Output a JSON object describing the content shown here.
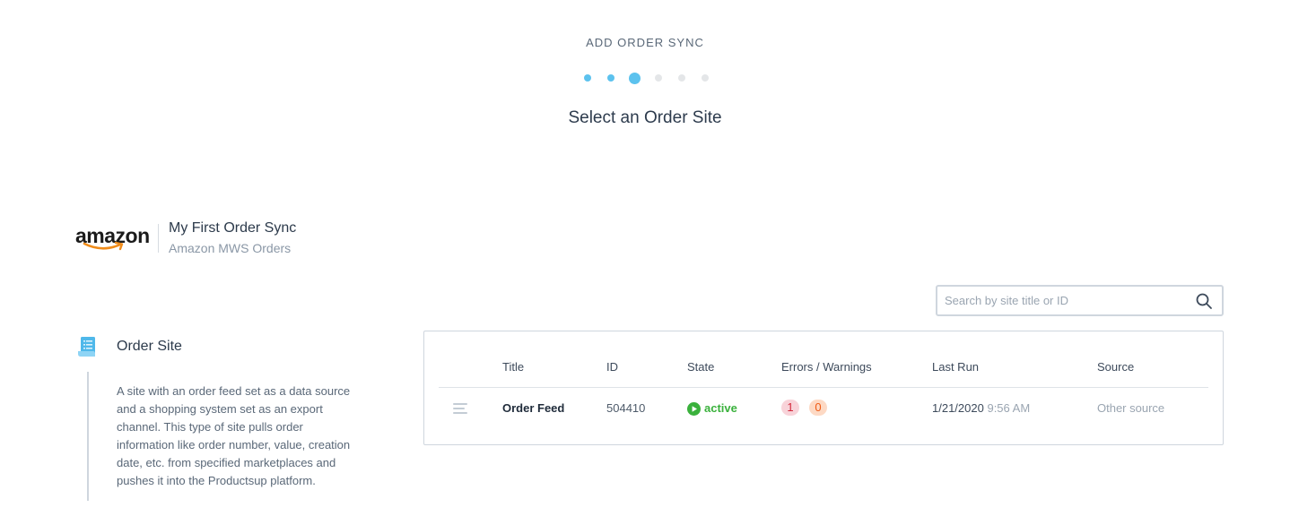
{
  "wizard": {
    "kicker": "ADD ORDER SYNC",
    "title": "Select an Order Site",
    "steps_total": 6,
    "current_step": 3,
    "accent_color": "#5cc2ee"
  },
  "sync": {
    "logo_text": "amazon",
    "logo_icon": "amazon-logo",
    "name": "My First Order Sync",
    "type": "Amazon MWS Orders"
  },
  "search": {
    "placeholder": "Search by site title or ID",
    "value": "",
    "icon": "search-icon"
  },
  "site_type": {
    "icon": "document-icon",
    "label": "Order Site",
    "description": "A site with an order feed set as a data source and a shopping system set as an export channel. This type of site pulls order information like order number, value, creation date, etc. from specified marketplaces and pushes it into the Productsup platform."
  },
  "table": {
    "columns": [
      "Title",
      "ID",
      "State",
      "Errors / Warnings",
      "Last Run",
      "Source"
    ],
    "rows": [
      {
        "title": "Order Feed",
        "id": "504410",
        "state": "active",
        "errors": "1",
        "warnings": "0",
        "last_run_date": "1/21/2020",
        "last_run_time": "9:56 AM",
        "source": "Other source"
      }
    ]
  },
  "colors": {
    "active": "#3ab13c",
    "error_bg": "#f8d3d9",
    "error_fg": "#d2283b",
    "warning_bg": "#fdd9c4",
    "warning_fg": "#ef5a14"
  }
}
